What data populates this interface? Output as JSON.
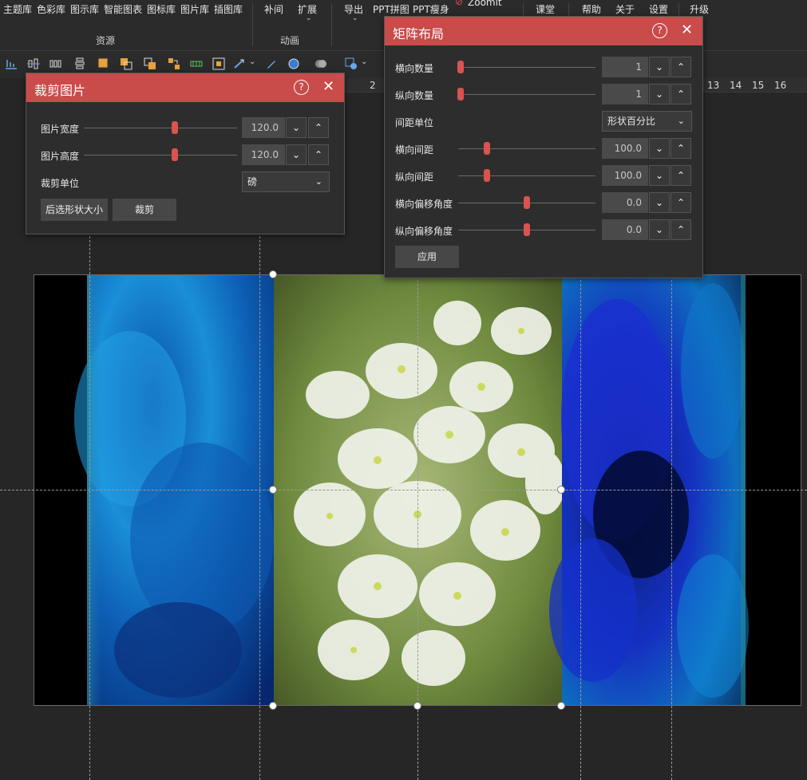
{
  "ribbon": {
    "items": [
      "主题库",
      "色彩库",
      "图示库",
      "智能图表",
      "图标库",
      "图片库",
      "插图库",
      "补间",
      "扩展",
      "导出",
      "PPT拼图",
      "PPT瘦身",
      "Zoomit",
      "课堂",
      "帮助",
      "关于",
      "设置",
      "升级"
    ],
    "groups": [
      "资源",
      "动画"
    ]
  },
  "ruler": [
    "2",
    "13",
    "14",
    "15",
    "16"
  ],
  "crop_dialog": {
    "title": "裁剪图片",
    "width_label": "图片宽度",
    "width_value": "120.0",
    "height_label": "图片高度",
    "height_value": "120.0",
    "unit_label": "裁剪单位",
    "unit_value": "磅",
    "btn_fit": "后选形状大小",
    "btn_crop": "裁剪"
  },
  "matrix_dialog": {
    "title": "矩阵布局",
    "h_count_label": "横向数量",
    "h_count_value": "1",
    "v_count_label": "纵向数量",
    "v_count_value": "1",
    "spacing_unit_label": "间距单位",
    "spacing_unit_value": "形状百分比",
    "h_spacing_label": "横向间距",
    "h_spacing_value": "100.0",
    "v_spacing_label": "纵向间距",
    "v_spacing_value": "100.0",
    "h_offset_label": "横向偏移角度",
    "h_offset_value": "0.0",
    "v_offset_label": "纵向偏移角度",
    "v_offset_value": "0.0",
    "apply_label": "应用"
  },
  "icons": [
    "help-icon",
    "close-icon",
    "chevron-down-icon",
    "chevron-up-icon"
  ],
  "colors": {
    "accent": "#c94b4a",
    "slider": "#d9534f",
    "background": "#262626"
  }
}
